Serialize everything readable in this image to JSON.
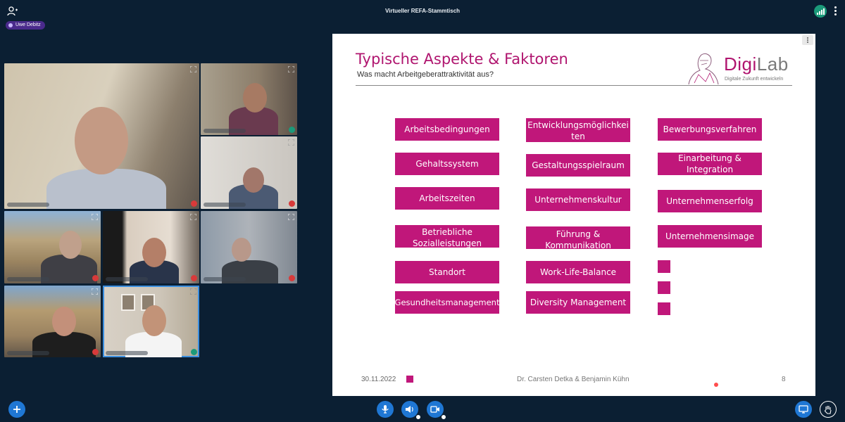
{
  "meeting": {
    "title": "Virtueller REFA-Stammtisch",
    "talking_user": "Uwe Debitz"
  },
  "slide": {
    "title": "Typische Aspekte & Faktoren",
    "subtitle": "Was macht Arbeitgeberattraktivität aus?",
    "logo": {
      "digi": "Digi",
      "lab": "Lab",
      "tagline": "Digitale Zukunft entwickeln"
    },
    "columns": [
      [
        "Arbeitsbedingungen",
        "Gehaltssystem",
        "Arbeitszeiten",
        "Betriebliche Sozialleistungen",
        "Standort",
        "Gesundheitsmanagement"
      ],
      [
        "Entwicklungsmöglichkeiten",
        "Gestaltungsspielraum",
        "Unternehmenskultur",
        "Führung & Kommunikation",
        "Work-Life-Balance",
        "Diversity Management"
      ],
      [
        "Bewerbungsverfahren",
        "Einarbeitung & Integration",
        "Unternehmenserfolg",
        "Unternehmensimage"
      ]
    ],
    "footer": {
      "date": "30.11.2022",
      "authors": "Dr. Carsten Detka & Benjamin Kühn",
      "page": "8"
    }
  },
  "colors": {
    "accent": "#c0177a",
    "background": "#0b1f33",
    "control": "#1f77d4"
  },
  "icons": [
    "users-icon",
    "connection-status-icon",
    "menu-icon",
    "expand-icon",
    "mic-muted-icon",
    "mic-on-icon",
    "plus-icon",
    "microphone-icon",
    "speaker-icon",
    "camera-icon",
    "screen-share-icon",
    "raise-hand-icon"
  ]
}
